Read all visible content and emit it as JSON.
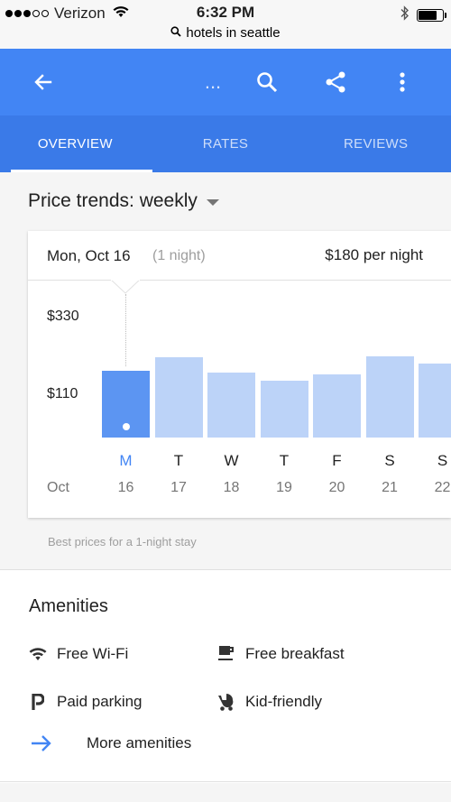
{
  "status_bar": {
    "carrier": "Verizon",
    "time": "6:32 PM",
    "url": "hotels in seattle"
  },
  "app_bar": {
    "more_dots": "..."
  },
  "tabs": [
    {
      "label": "OVERVIEW",
      "active": true
    },
    {
      "label": "RATES",
      "active": false
    },
    {
      "label": "REVIEWS",
      "active": false
    }
  ],
  "price_trends": {
    "title": "Price trends: weekly",
    "selected_date": "Mon, Oct 16",
    "nights": "(1 night)",
    "price_per_night": "$180 per night",
    "footnote": "Best prices for a 1-night stay"
  },
  "chart_data": {
    "type": "bar",
    "categories": [
      "M 16",
      "T 17",
      "W 18",
      "T 19",
      "F 20",
      "S 21",
      "S 22"
    ],
    "day_letters": [
      "M",
      "T",
      "W",
      "T",
      "F",
      "S",
      "S"
    ],
    "dates": [
      "16",
      "17",
      "18",
      "19",
      "20",
      "21",
      "22"
    ],
    "month": "Oct",
    "values": [
      180,
      218,
      175,
      150,
      170,
      221,
      200
    ],
    "y_tick_labels": [
      "$330",
      "$110"
    ],
    "y_ticks": [
      330,
      110
    ],
    "selected_index": 0,
    "colors": {
      "selected": "#5c95f2",
      "default": "#bcd3f8"
    }
  },
  "amenities": {
    "title": "Amenities",
    "items": [
      {
        "label": "Free Wi-Fi",
        "icon": "wifi-icon"
      },
      {
        "label": "Free breakfast",
        "icon": "coffee-icon"
      },
      {
        "label": "Paid parking",
        "icon": "parking-icon"
      },
      {
        "label": "Kid-friendly",
        "icon": "stroller-icon"
      }
    ],
    "more_label": "More amenities"
  },
  "colors": {
    "app_bar": "#4285f4",
    "tabs_bar": "#3a7ae8",
    "accent": "#4285f4"
  }
}
